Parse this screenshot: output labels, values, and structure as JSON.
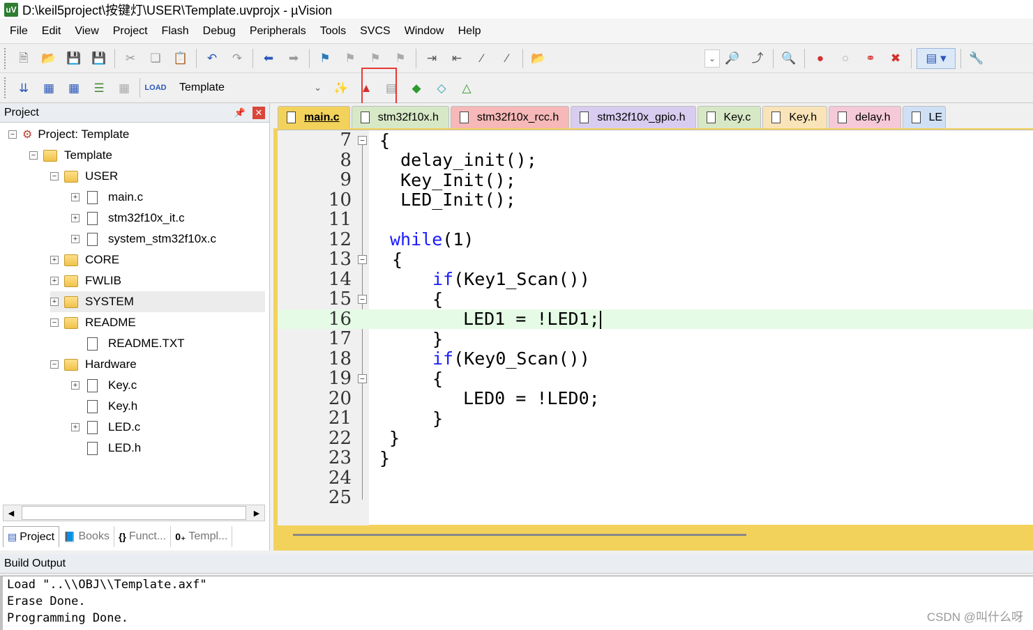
{
  "window": {
    "title": "D:\\keil5project\\按键灯\\USER\\Template.uvprojx - µVision",
    "app_icon": "uv"
  },
  "menu": [
    "File",
    "Edit",
    "View",
    "Project",
    "Flash",
    "Debug",
    "Peripherals",
    "Tools",
    "SVCS",
    "Window",
    "Help"
  ],
  "toolbar": {
    "target": "Target",
    "target_value": "Template"
  },
  "project_panel": {
    "title": "Project",
    "pin": "ᵖ",
    "tree": [
      {
        "label": "Project: Template",
        "kind": "project"
      },
      {
        "label": "Template",
        "kind": "target"
      },
      {
        "label": "USER",
        "kind": "folder"
      },
      {
        "label": "main.c",
        "kind": "file"
      },
      {
        "label": "stm32f10x_it.c",
        "kind": "file"
      },
      {
        "label": "system_stm32f10x.c",
        "kind": "file"
      },
      {
        "label": "CORE",
        "kind": "folder"
      },
      {
        "label": "FWLIB",
        "kind": "folder"
      },
      {
        "label": "SYSTEM",
        "kind": "folder",
        "selected": true
      },
      {
        "label": "README",
        "kind": "folder"
      },
      {
        "label": "README.TXT",
        "kind": "file"
      },
      {
        "label": "Hardware",
        "kind": "folder"
      },
      {
        "label": "Key.c",
        "kind": "file"
      },
      {
        "label": "Key.h",
        "kind": "file"
      },
      {
        "label": "LED.c",
        "kind": "file"
      },
      {
        "label": "LED.h",
        "kind": "file"
      }
    ],
    "bottom_tabs": [
      "Project",
      "Books",
      "Funct...",
      "Templ..."
    ]
  },
  "editor": {
    "tabs": [
      "main.c",
      "stm32f10x.h",
      "stm32f10x_rcc.h",
      "stm32f10x_gpio.h",
      "Key.c",
      "Key.h",
      "delay.h",
      "LE"
    ],
    "active_tab": "main.c",
    "tab_colors": [
      "#f3d25b",
      "#d7e8c6",
      "#f6b8b8",
      "#d8cdf0",
      "#d7e8c6",
      "#f9e3b8",
      "#f6c9d8",
      "#cfe0f5"
    ],
    "lines": [
      {
        "n": "7",
        "text": "{"
      },
      {
        "n": "8",
        "text": "  delay_init();"
      },
      {
        "n": "9",
        "text": "  Key_Init();"
      },
      {
        "n": "10",
        "text": "  LED_Init();"
      },
      {
        "n": "11",
        "text": ""
      },
      {
        "n": "12",
        "kw": "while",
        "text": "(1)"
      },
      {
        "n": "13",
        "text": "{"
      },
      {
        "n": "14",
        "kw": "if",
        "text": "(Key1_Scan())"
      },
      {
        "n": "15",
        "text": "{"
      },
      {
        "n": "16",
        "text": "LED1 = !LED1;"
      },
      {
        "n": "17",
        "text": "}"
      },
      {
        "n": "18",
        "kw": "if",
        "text": "(Key0_Scan())"
      },
      {
        "n": "19",
        "text": "{"
      },
      {
        "n": "20",
        "text": "LED0 = !LED0;"
      },
      {
        "n": "21",
        "text": "}"
      },
      {
        "n": "22",
        "text": "}"
      },
      {
        "n": "23",
        "text": "}"
      },
      {
        "n": "24",
        "text": ""
      },
      {
        "n": "25",
        "text": ""
      }
    ]
  },
  "build_output": {
    "title": "Build Output",
    "lines": [
      "Load \"..\\\\OBJ\\\\Template.axf\"",
      "Erase Done.",
      "Programming Done."
    ]
  },
  "watermark": "CSDN @叫什么呀"
}
